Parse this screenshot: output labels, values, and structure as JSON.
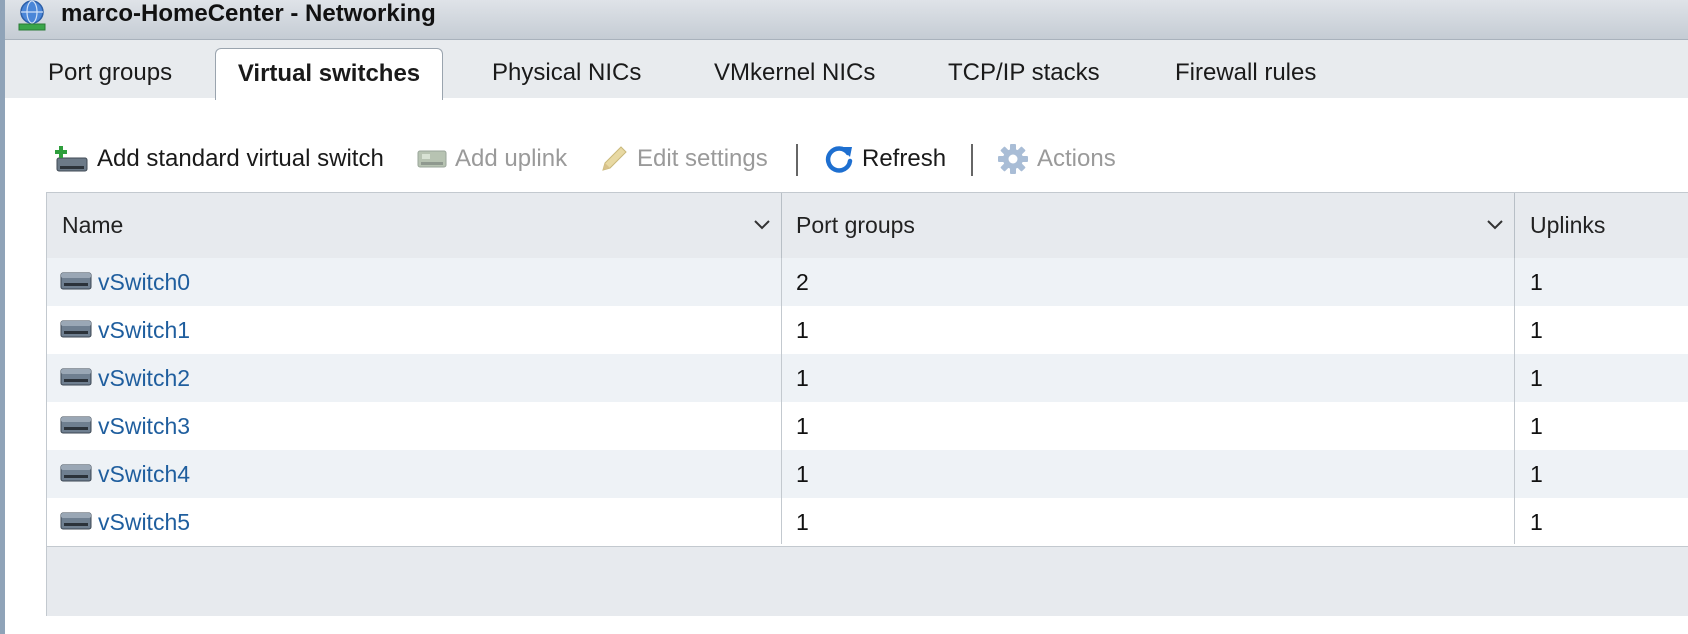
{
  "window": {
    "title": "marco-HomeCenter - Networking",
    "icon": "networking-globe-icon"
  },
  "tabs": [
    {
      "label": "Port groups",
      "active": false
    },
    {
      "label": "Virtual switches",
      "active": true
    },
    {
      "label": "Physical NICs",
      "active": false
    },
    {
      "label": "VMkernel NICs",
      "active": false
    },
    {
      "label": "TCP/IP stacks",
      "active": false
    },
    {
      "label": "Firewall rules",
      "active": false
    }
  ],
  "toolbar": {
    "add_switch": {
      "label": "Add standard virtual switch",
      "icon": "add-switch-icon",
      "enabled": true
    },
    "add_uplink": {
      "label": "Add uplink",
      "icon": "add-uplink-icon",
      "enabled": false
    },
    "edit_settings": {
      "label": "Edit settings",
      "icon": "pencil-icon",
      "enabled": false
    },
    "refresh": {
      "label": "Refresh",
      "icon": "refresh-icon",
      "enabled": true
    },
    "actions": {
      "label": "Actions",
      "icon": "gear-icon",
      "enabled": false
    }
  },
  "table": {
    "columns": [
      "Name",
      "Port groups",
      "Uplinks"
    ],
    "rows": [
      {
        "name": "vSwitch0",
        "port_groups": "2",
        "uplinks": "1"
      },
      {
        "name": "vSwitch1",
        "port_groups": "1",
        "uplinks": "1"
      },
      {
        "name": "vSwitch2",
        "port_groups": "1",
        "uplinks": "1"
      },
      {
        "name": "vSwitch3",
        "port_groups": "1",
        "uplinks": "1"
      },
      {
        "name": "vSwitch4",
        "port_groups": "1",
        "uplinks": "1"
      },
      {
        "name": "vSwitch5",
        "port_groups": "1",
        "uplinks": "1"
      }
    ]
  },
  "colors": {
    "link": "#1f5e9e",
    "refresh_blue": "#1e6fd0",
    "header_bg": "#e7eaee",
    "row_alt": "#eef2f6"
  }
}
